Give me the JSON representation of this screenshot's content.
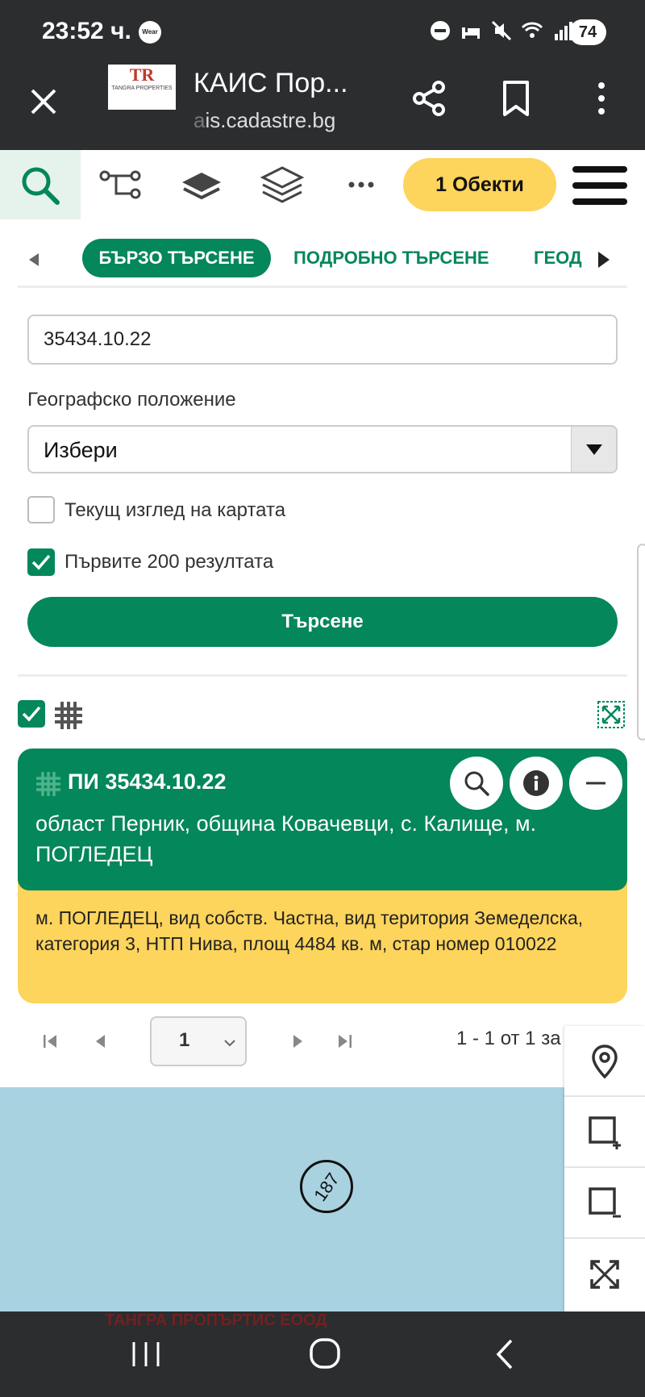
{
  "status_bar": {
    "time": "23:52 ч.",
    "wear_badge": "Wear",
    "battery": "74"
  },
  "browser": {
    "logo_initials": "TR",
    "logo_text": "TANGRA PROPERTIES",
    "title": "КАИС Пор...",
    "url_faded": "a",
    "url": "is.cadastre.bg"
  },
  "toolbar": {
    "objects_button": "1 Обекти"
  },
  "tabs": {
    "quick_search": "БЪРЗО ТЪРСЕНЕ",
    "detailed_search": "ПОДРОБНО ТЪРСЕНЕ",
    "geo": "ГЕОД"
  },
  "form": {
    "search_value": "35434.10.22",
    "geo_label": "Географско положение",
    "geo_select_value": "Избери",
    "current_view_label": "Текущ изглед на картата",
    "current_view_checked": false,
    "first200_label": "Първите 200 резултата",
    "first200_checked": true,
    "search_button": "Търсене"
  },
  "result": {
    "title": "ПИ 35434.10.22",
    "address": "област Перник, община Ковачевци, с. Калище, м. ПОГЛЕДЕЦ",
    "description": "м. ПОГЛЕДЕЦ, вид собств. Частна, вид територия Земеделска, категория 3, НТП Нива, площ 4484 кв. м, стар номер 010022"
  },
  "pagination": {
    "page": "1",
    "info": "1 - 1 от 1 за"
  },
  "map": {
    "parcel_label": "187"
  },
  "watermark": "ТАНГРА ПРОПЪРТИС ЕООД",
  "colors": {
    "accent_green": "#04875a",
    "accent_yellow": "#fdd45c",
    "map_water": "#a8d2e0",
    "system_bar": "#2b2d2f"
  }
}
